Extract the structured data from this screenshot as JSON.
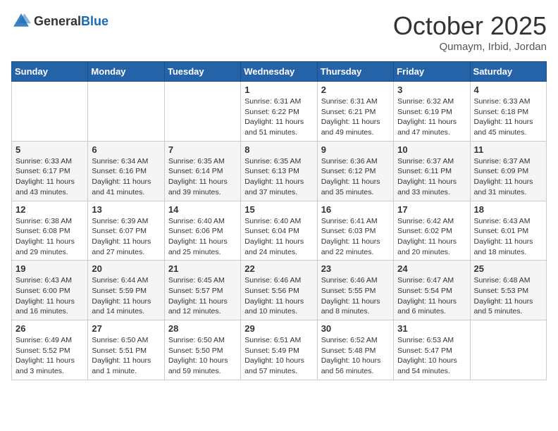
{
  "header": {
    "logo_general": "General",
    "logo_blue": "Blue",
    "month_title": "October 2025",
    "location": "Qumaym, Irbid, Jordan"
  },
  "days_of_week": [
    "Sunday",
    "Monday",
    "Tuesday",
    "Wednesday",
    "Thursday",
    "Friday",
    "Saturday"
  ],
  "weeks": [
    [
      {
        "day": "",
        "info": ""
      },
      {
        "day": "",
        "info": ""
      },
      {
        "day": "",
        "info": ""
      },
      {
        "day": "1",
        "info": "Sunrise: 6:31 AM\nSunset: 6:22 PM\nDaylight: 11 hours\nand 51 minutes."
      },
      {
        "day": "2",
        "info": "Sunrise: 6:31 AM\nSunset: 6:21 PM\nDaylight: 11 hours\nand 49 minutes."
      },
      {
        "day": "3",
        "info": "Sunrise: 6:32 AM\nSunset: 6:19 PM\nDaylight: 11 hours\nand 47 minutes."
      },
      {
        "day": "4",
        "info": "Sunrise: 6:33 AM\nSunset: 6:18 PM\nDaylight: 11 hours\nand 45 minutes."
      }
    ],
    [
      {
        "day": "5",
        "info": "Sunrise: 6:33 AM\nSunset: 6:17 PM\nDaylight: 11 hours\nand 43 minutes."
      },
      {
        "day": "6",
        "info": "Sunrise: 6:34 AM\nSunset: 6:16 PM\nDaylight: 11 hours\nand 41 minutes."
      },
      {
        "day": "7",
        "info": "Sunrise: 6:35 AM\nSunset: 6:14 PM\nDaylight: 11 hours\nand 39 minutes."
      },
      {
        "day": "8",
        "info": "Sunrise: 6:35 AM\nSunset: 6:13 PM\nDaylight: 11 hours\nand 37 minutes."
      },
      {
        "day": "9",
        "info": "Sunrise: 6:36 AM\nSunset: 6:12 PM\nDaylight: 11 hours\nand 35 minutes."
      },
      {
        "day": "10",
        "info": "Sunrise: 6:37 AM\nSunset: 6:11 PM\nDaylight: 11 hours\nand 33 minutes."
      },
      {
        "day": "11",
        "info": "Sunrise: 6:37 AM\nSunset: 6:09 PM\nDaylight: 11 hours\nand 31 minutes."
      }
    ],
    [
      {
        "day": "12",
        "info": "Sunrise: 6:38 AM\nSunset: 6:08 PM\nDaylight: 11 hours\nand 29 minutes."
      },
      {
        "day": "13",
        "info": "Sunrise: 6:39 AM\nSunset: 6:07 PM\nDaylight: 11 hours\nand 27 minutes."
      },
      {
        "day": "14",
        "info": "Sunrise: 6:40 AM\nSunset: 6:06 PM\nDaylight: 11 hours\nand 25 minutes."
      },
      {
        "day": "15",
        "info": "Sunrise: 6:40 AM\nSunset: 6:04 PM\nDaylight: 11 hours\nand 24 minutes."
      },
      {
        "day": "16",
        "info": "Sunrise: 6:41 AM\nSunset: 6:03 PM\nDaylight: 11 hours\nand 22 minutes."
      },
      {
        "day": "17",
        "info": "Sunrise: 6:42 AM\nSunset: 6:02 PM\nDaylight: 11 hours\nand 20 minutes."
      },
      {
        "day": "18",
        "info": "Sunrise: 6:43 AM\nSunset: 6:01 PM\nDaylight: 11 hours\nand 18 minutes."
      }
    ],
    [
      {
        "day": "19",
        "info": "Sunrise: 6:43 AM\nSunset: 6:00 PM\nDaylight: 11 hours\nand 16 minutes."
      },
      {
        "day": "20",
        "info": "Sunrise: 6:44 AM\nSunset: 5:59 PM\nDaylight: 11 hours\nand 14 minutes."
      },
      {
        "day": "21",
        "info": "Sunrise: 6:45 AM\nSunset: 5:57 PM\nDaylight: 11 hours\nand 12 minutes."
      },
      {
        "day": "22",
        "info": "Sunrise: 6:46 AM\nSunset: 5:56 PM\nDaylight: 11 hours\nand 10 minutes."
      },
      {
        "day": "23",
        "info": "Sunrise: 6:46 AM\nSunset: 5:55 PM\nDaylight: 11 hours\nand 8 minutes."
      },
      {
        "day": "24",
        "info": "Sunrise: 6:47 AM\nSunset: 5:54 PM\nDaylight: 11 hours\nand 6 minutes."
      },
      {
        "day": "25",
        "info": "Sunrise: 6:48 AM\nSunset: 5:53 PM\nDaylight: 11 hours\nand 5 minutes."
      }
    ],
    [
      {
        "day": "26",
        "info": "Sunrise: 6:49 AM\nSunset: 5:52 PM\nDaylight: 11 hours\nand 3 minutes."
      },
      {
        "day": "27",
        "info": "Sunrise: 6:50 AM\nSunset: 5:51 PM\nDaylight: 11 hours\nand 1 minute."
      },
      {
        "day": "28",
        "info": "Sunrise: 6:50 AM\nSunset: 5:50 PM\nDaylight: 10 hours\nand 59 minutes."
      },
      {
        "day": "29",
        "info": "Sunrise: 6:51 AM\nSunset: 5:49 PM\nDaylight: 10 hours\nand 57 minutes."
      },
      {
        "day": "30",
        "info": "Sunrise: 6:52 AM\nSunset: 5:48 PM\nDaylight: 10 hours\nand 56 minutes."
      },
      {
        "day": "31",
        "info": "Sunrise: 6:53 AM\nSunset: 5:47 PM\nDaylight: 10 hours\nand 54 minutes."
      },
      {
        "day": "",
        "info": ""
      }
    ]
  ]
}
